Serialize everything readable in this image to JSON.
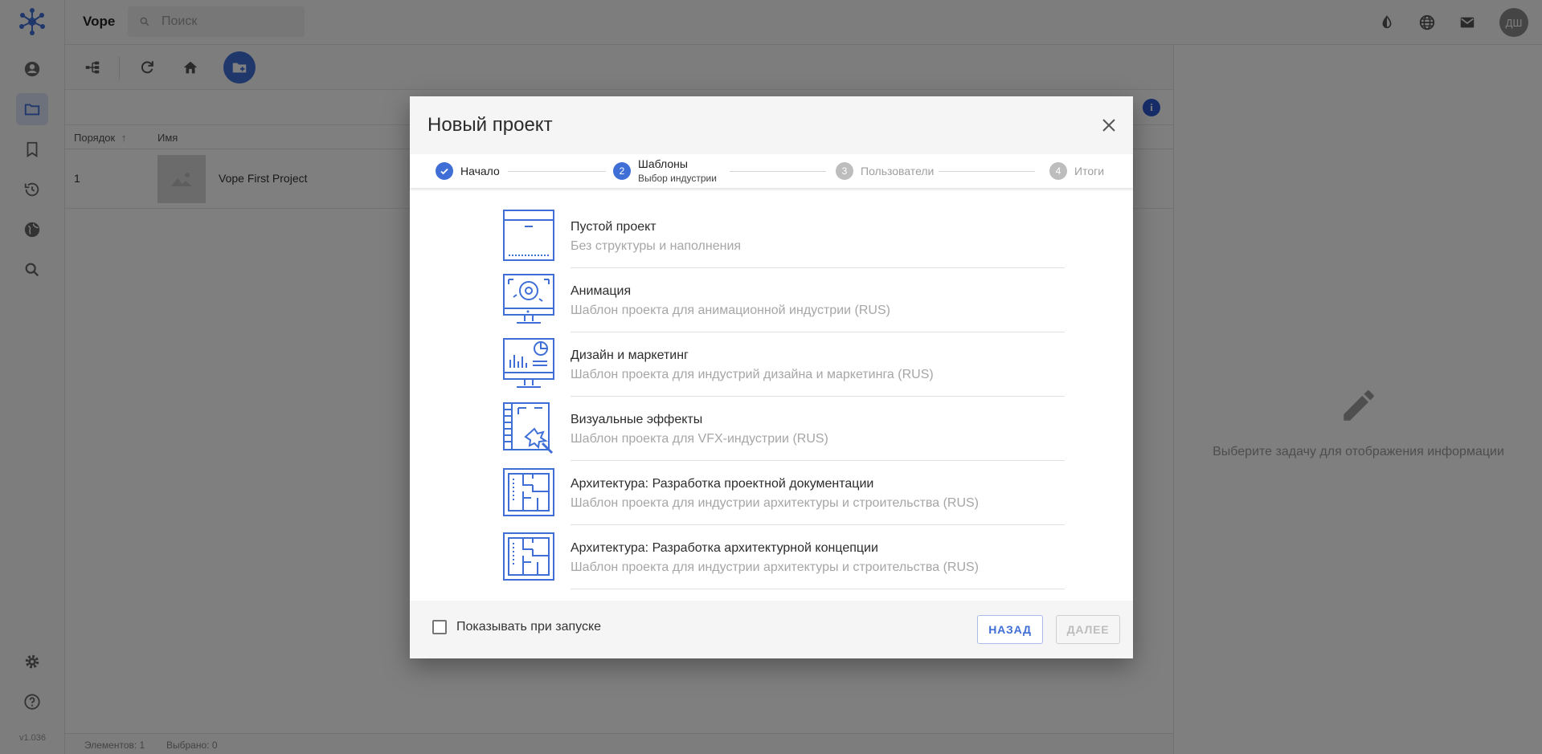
{
  "app": {
    "title": "Vope",
    "version": "v1.036",
    "search_placeholder": "Поиск",
    "avatar_initials": "ДШ"
  },
  "table": {
    "headers": {
      "order": "Порядок",
      "name": "Имя"
    },
    "rows": [
      {
        "order": "1",
        "name": "Vope First Project"
      }
    ]
  },
  "right_panel": {
    "message": "Выберите задачу для отображения информации"
  },
  "statusbar": {
    "elements": "Элементов: 1",
    "selected": "Выбрано: 0"
  },
  "modal": {
    "title": "Новый проект",
    "steps": [
      {
        "num": "1",
        "label": "Начало",
        "status": "done"
      },
      {
        "num": "2",
        "label": "Шаблоны",
        "sub": "Выбор индустрии",
        "status": "active"
      },
      {
        "num": "3",
        "label": "Пользователи",
        "status": "pending"
      },
      {
        "num": "4",
        "label": "Итоги",
        "status": "pending"
      }
    ],
    "templates": [
      {
        "name": "Пустой проект",
        "desc": "Без структуры и наполнения",
        "icon": "box-icon"
      },
      {
        "name": "Анимация",
        "desc": "Шаблон проекта для анимационной индустрии (RUS)",
        "icon": "animation-monitor-icon"
      },
      {
        "name": "Дизайн и маркетинг",
        "desc": "Шаблон проекта для индустрий дизайна и маркетинга (RUS)",
        "icon": "analytics-monitor-icon"
      },
      {
        "name": "Визуальные эффекты",
        "desc": "Шаблон проекта для VFX-индустрии (RUS)",
        "icon": "vfx-film-icon"
      },
      {
        "name": "Архитектура: Разработка проектной документации",
        "desc": "Шаблон проекта для индустрии архитектуры и строительства (RUS)",
        "icon": "floor-plan-icon"
      },
      {
        "name": "Архитектура: Разработка архитектурной концепции",
        "desc": "Шаблон проекта для индустрии архитектуры и строительства (RUS)",
        "icon": "floor-plan-icon"
      }
    ],
    "footer": {
      "show_on_startup_label": "Показывать при запуске",
      "show_on_startup_checked": false,
      "back_label": "НАЗАД",
      "next_label": "ДАЛЕЕ"
    }
  },
  "colors": {
    "accent": "#3f6fd6",
    "overlay": "rgba(0,0,0,0.5)"
  }
}
